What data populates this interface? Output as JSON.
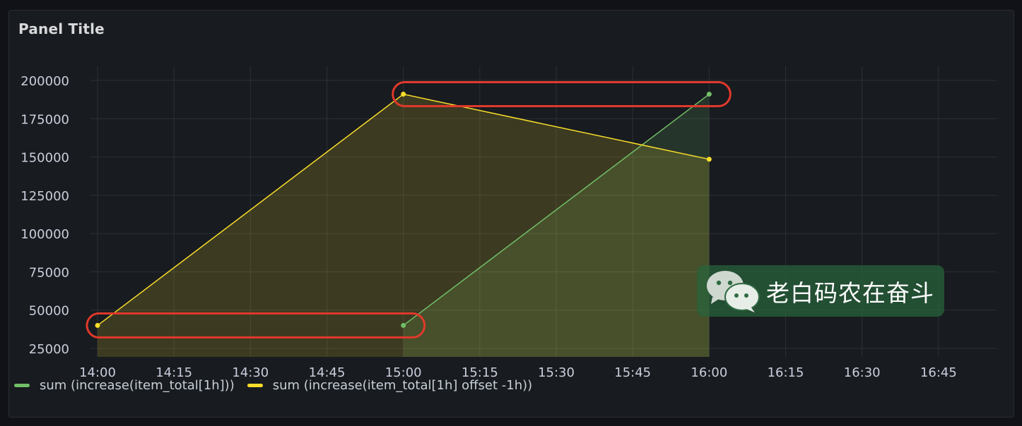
{
  "panel": {
    "title": "Panel Title"
  },
  "watermark": {
    "text": "老白码农在奋斗",
    "icon": "wechat-icon"
  },
  "colors": {
    "background": "#111217",
    "panel": "#181b1f",
    "grid": "#2c3036",
    "axis_text": "#ccccdc",
    "series_green": "#73bf69",
    "series_yellow": "#fade2a",
    "highlight": "#e0392b"
  },
  "chart_data": {
    "type": "line",
    "title": "Panel Title",
    "x_ticks": [
      "14:00",
      "14:15",
      "14:30",
      "14:45",
      "15:00",
      "15:15",
      "15:30",
      "15:45",
      "16:00",
      "16:15",
      "16:30",
      "16:45"
    ],
    "x_tick_minutes": [
      0,
      15,
      30,
      45,
      60,
      75,
      90,
      105,
      120,
      135,
      150,
      165
    ],
    "x_range_minutes": [
      0,
      175
    ],
    "y_ticks": [
      25000,
      50000,
      75000,
      100000,
      125000,
      150000,
      175000,
      200000
    ],
    "y_tick_labels": [
      "25000",
      "50000",
      "75000",
      "100000",
      "125000",
      "150000",
      "175000",
      "200000"
    ],
    "ylim": [
      20000,
      210000
    ],
    "grid": true,
    "legend_placement": "bottom-left",
    "series": [
      {
        "name": "sum (increase(item_total[1h]))",
        "color": "#73bf69",
        "x": [
          "15:00",
          "16:00"
        ],
        "x_minutes": [
          60,
          120
        ],
        "values": [
          40000,
          191000
        ],
        "fill": true
      },
      {
        "name": "sum (increase(item_total[1h] offset -1h))",
        "color": "#fade2a",
        "x": [
          "14:00",
          "15:00",
          "16:00"
        ],
        "x_minutes": [
          0,
          60,
          120
        ],
        "values": [
          40000,
          191000,
          148500
        ],
        "fill": true
      }
    ],
    "annotations": [
      {
        "type": "highlight-ellipse",
        "around_values": [
          40000,
          40000
        ],
        "x_minutes": [
          0,
          60
        ]
      },
      {
        "type": "highlight-ellipse",
        "around_values": [
          191000,
          191000
        ],
        "x_minutes": [
          60,
          120
        ]
      }
    ]
  }
}
